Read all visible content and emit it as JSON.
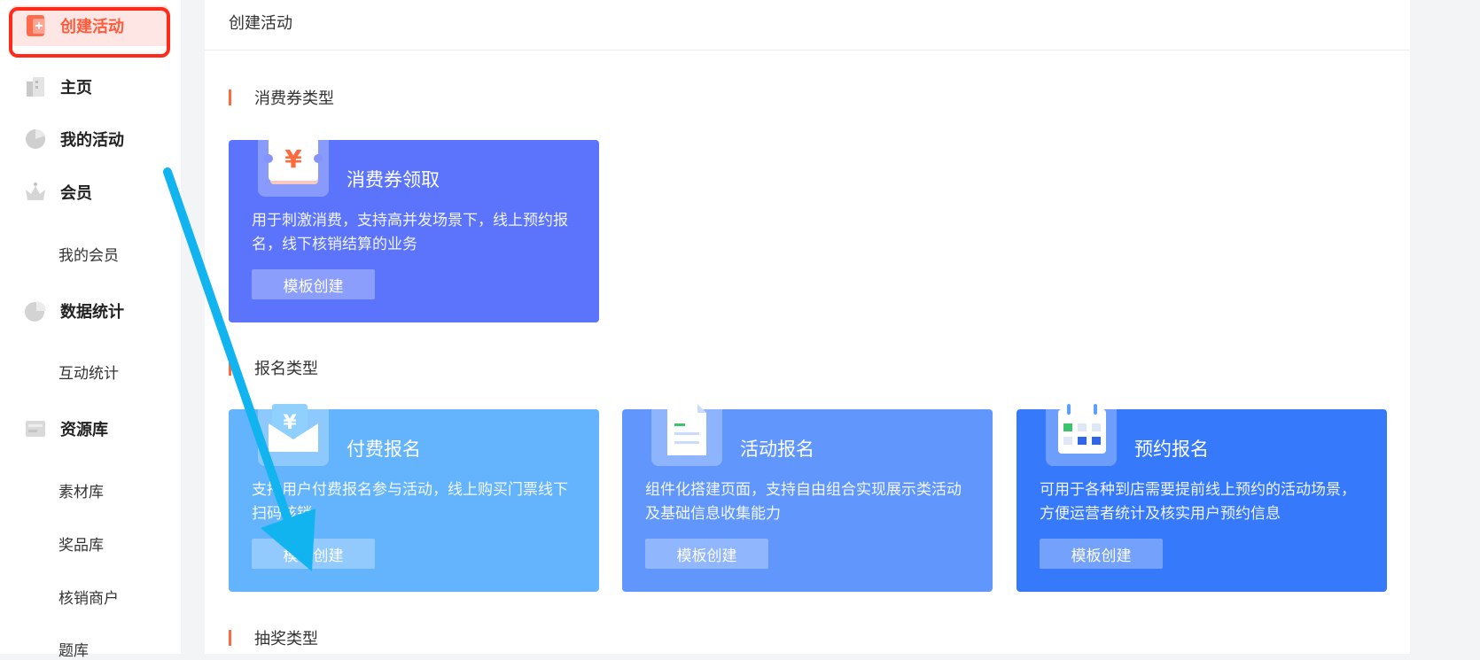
{
  "sidebar": {
    "items": [
      {
        "label": "创建活动",
        "icon": "create-activity-icon"
      },
      {
        "label": "主页",
        "icon": "home-icon"
      },
      {
        "label": "我的活动",
        "icon": "my-activity-icon"
      },
      {
        "label": "会员",
        "icon": "member-icon"
      },
      {
        "label": "我的会员"
      },
      {
        "label": "数据统计",
        "icon": "stats-icon"
      },
      {
        "label": "互动统计"
      },
      {
        "label": "资源库",
        "icon": "resource-icon"
      },
      {
        "label": "素材库"
      },
      {
        "label": "奖品库"
      },
      {
        "label": "核销商户"
      },
      {
        "label": "题库"
      }
    ]
  },
  "main": {
    "title": "创建活动",
    "sections": [
      {
        "title": "消费券类型",
        "cards": [
          {
            "title": "消费券领取",
            "desc": "用于刺激消费，支持高并发场景下，线上预约报名，线下核销结算的业务",
            "button": "模板创建",
            "icon": "coupon-icon"
          }
        ]
      },
      {
        "title": "报名类型",
        "cards": [
          {
            "title": "付费报名",
            "desc": "支持用户付费报名参与活动，线上购买门票线下扫码核销",
            "button": "模板创建",
            "icon": "payment-envelope-icon"
          },
          {
            "title": "活动报名",
            "desc": "组件化搭建页面，支持自由组合实现展示类活动及基础信息收集能力",
            "button": "模板创建",
            "icon": "document-icon"
          },
          {
            "title": "预约报名",
            "desc": "可用于各种到店需要提前线上预约的活动场景，方便运营者统计及核实用户预约信息",
            "button": "模板创建",
            "icon": "calendar-icon"
          }
        ]
      },
      {
        "title": "抽奖类型",
        "cards": []
      }
    ]
  },
  "colors": {
    "accent": "#ff5a3c",
    "highlight_box": "#ff2a1a",
    "annotation_arrow": "#12b4f0",
    "card_coupon": "#5b74fb",
    "card_paid": "#63b4fd",
    "card_activity": "#6197fc",
    "card_booking": "#3779fb"
  }
}
